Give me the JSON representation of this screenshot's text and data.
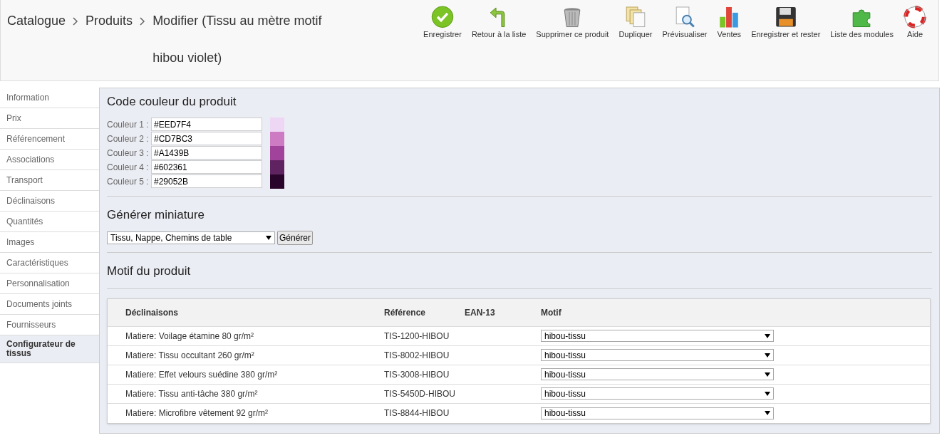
{
  "breadcrumb": [
    {
      "label": "Catalogue"
    },
    {
      "label": "Produits"
    },
    {
      "label": "Modifier (Tissu au mètre motif hibou violet)"
    }
  ],
  "toolbar": [
    {
      "label": "Enregistrer"
    },
    {
      "label": "Retour à la liste"
    },
    {
      "label": "Supprimer ce produit"
    },
    {
      "label": "Dupliquer"
    },
    {
      "label": "Prévisualiser"
    },
    {
      "label": "Ventes"
    },
    {
      "label": "Enregistrer et rester"
    },
    {
      "label": "Liste des modules"
    },
    {
      "label": "Aide"
    }
  ],
  "sidebar": {
    "items": [
      {
        "label": "Information",
        "selected": false
      },
      {
        "label": "Prix",
        "selected": false
      },
      {
        "label": "Référencement",
        "selected": false
      },
      {
        "label": "Associations",
        "selected": false
      },
      {
        "label": "Transport",
        "selected": false
      },
      {
        "label": "Déclinaisons",
        "selected": false
      },
      {
        "label": "Quantités",
        "selected": false
      },
      {
        "label": "Images",
        "selected": false
      },
      {
        "label": "Caractéristiques",
        "selected": false
      },
      {
        "label": "Personnalisation",
        "selected": false
      },
      {
        "label": "Documents joints",
        "selected": false
      },
      {
        "label": "Fournisseurs",
        "selected": false
      },
      {
        "label": "Configurateur de tissus",
        "selected": true
      }
    ]
  },
  "color_section": {
    "title": "Code couleur du produit",
    "colors": [
      {
        "label": "Couleur 1 :",
        "value": "#EED7F4",
        "color": "#eed7f4"
      },
      {
        "label": "Couleur 2 :",
        "value": "#CD7BC3",
        "color": "#cd7bc3"
      },
      {
        "label": "Couleur 3 :",
        "value": "#A1439B",
        "color": "#a1439b"
      },
      {
        "label": "Couleur 4 :",
        "value": "#602361",
        "color": "#602361"
      },
      {
        "label": "Couleur 5 :",
        "value": "#29052B",
        "color": "#29052b"
      }
    ]
  },
  "thumbnail_section": {
    "title": "Générer miniature",
    "select": "Tissu, Nappe, Chemins de table",
    "button": "Générer"
  },
  "pattern_section": {
    "title": "Motif du produit",
    "table": {
      "columns": [
        "Déclinaisons",
        "Référence",
        "EAN-13",
        "Motif"
      ],
      "rows": [
        {
          "name": "Matiere: Voilage étamine 80 gr/m²",
          "reference": "TIS-1200-HIBOU",
          "motif": "hibou-tissu"
        },
        {
          "name": "Matiere: Tissu occultant 260 gr/m²",
          "reference": "TIS-8002-HIBOU",
          "motif": "hibou-tissu"
        },
        {
          "name": "Matiere: Effet velours suédine 380 gr/m²",
          "reference": "TIS-3008-HIBOU",
          "motif": "hibou-tissu"
        },
        {
          "name": "Matiere: Tissu anti-tâche 380 gr/m²",
          "reference": "TIS-5450D-HIBOU",
          "motif": "hibou-tissu"
        },
        {
          "name": "Matiere: Microfibre vêtement 92 gr/m²",
          "reference": "TIS-8844-HIBOU",
          "motif": "hibou-tissu"
        }
      ]
    }
  }
}
